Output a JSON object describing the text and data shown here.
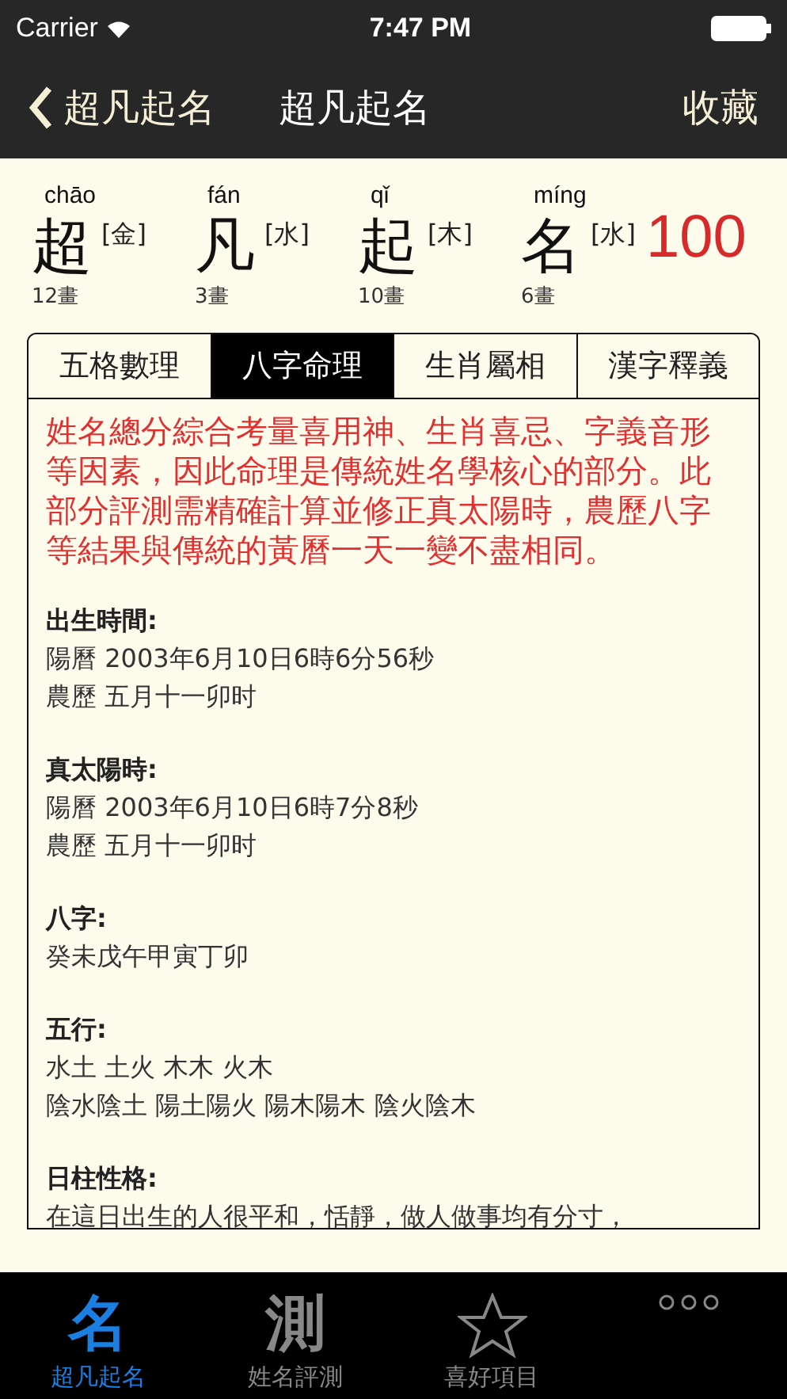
{
  "status_bar": {
    "carrier": "Carrier",
    "time": "7:47 PM"
  },
  "nav": {
    "back": "超凡起名",
    "title": "超凡起名",
    "action": "收藏"
  },
  "name_chars": [
    {
      "pinyin": "chāo",
      "char": "超",
      "element": "[金]",
      "strokes": "12畫"
    },
    {
      "pinyin": "fán",
      "char": "凡",
      "element": "[水]",
      "strokes": "3畫"
    },
    {
      "pinyin": "qǐ",
      "char": "起",
      "element": "[木]",
      "strokes": "10畫"
    },
    {
      "pinyin": "míng",
      "char": "名",
      "element": "[水]",
      "strokes": "6畫"
    }
  ],
  "score": "100",
  "tabs": [
    {
      "label": "五格數理",
      "selected": false
    },
    {
      "label": "八字命理",
      "selected": true
    },
    {
      "label": "生肖屬相",
      "selected": false
    },
    {
      "label": "漢字釋義",
      "selected": false
    }
  ],
  "intro": "姓名總分綜合考量喜用神、生肖喜忌、字義音形等因素，因此命理是傳統姓名學核心的部分。此部分評測需精確計算並修正真太陽時，農歷八字等結果與傳統的黃曆一天一變不盡相同。",
  "sections": [
    {
      "heading": "出生時間:",
      "lines": [
        "陽曆 2003年6月10日6時6分56秒",
        "農歷 五月十一卯时"
      ]
    },
    {
      "heading": "真太陽時:",
      "lines": [
        "陽曆 2003年6月10日6時7分8秒",
        "農歷 五月十一卯时"
      ]
    },
    {
      "heading": "八字:",
      "lines": [
        "癸未戊午甲寅丁卯"
      ]
    },
    {
      "heading": "五行:",
      "lines": [
        "水土 土火 木木 火木",
        "陰水陰土 陽土陽火 陽木陽木 陰火陰木"
      ]
    },
    {
      "heading": "日柱性格:",
      "lines": [
        "在這日出生的人很平和，恬靜，做人做事均有分寸，"
      ]
    }
  ],
  "tab_bar": [
    {
      "kind": "glyph",
      "glyph": "名",
      "label": "超凡起名",
      "selected": true
    },
    {
      "kind": "glyph",
      "glyph": "測",
      "label": "姓名評測",
      "selected": false
    },
    {
      "kind": "star",
      "label": "喜好項目",
      "selected": false
    },
    {
      "kind": "more",
      "selected": false
    }
  ]
}
